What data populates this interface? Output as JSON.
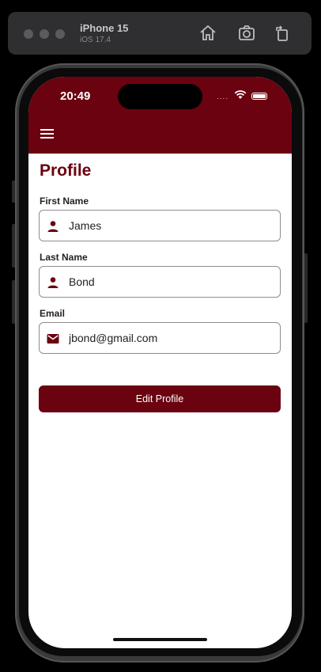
{
  "simulator": {
    "device_name": "iPhone 15",
    "os_version": "iOS 17.4",
    "toolbar_icons": [
      "home-icon",
      "screenshot-icon",
      "rotate-icon"
    ]
  },
  "status_bar": {
    "time": "20:49",
    "signal": "....",
    "icons": [
      "wifi-icon",
      "battery-icon"
    ]
  },
  "app_bar": {
    "menu_icon": "hamburger-menu-icon",
    "color": "#6b0210"
  },
  "page": {
    "title": "Profile",
    "fields": [
      {
        "label": "First Name",
        "value": "James",
        "icon": "person-icon"
      },
      {
        "label": "Last Name",
        "value": "Bond",
        "icon": "person-icon"
      },
      {
        "label": "Email",
        "value": "jbond@gmail.com",
        "icon": "mail-icon"
      }
    ],
    "edit_button_label": "Edit Profile"
  },
  "colors": {
    "accent": "#6b0210",
    "background": "#ffffff"
  }
}
